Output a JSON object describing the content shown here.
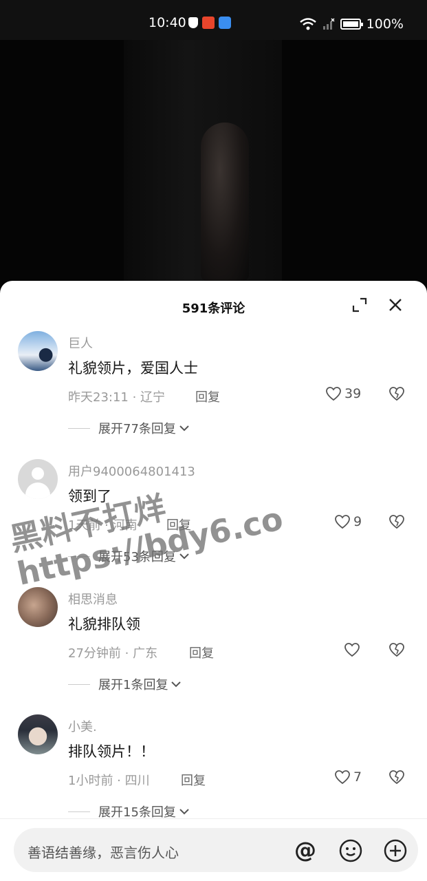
{
  "status_bar": {
    "time": "10:40",
    "battery": "100%"
  },
  "sheet": {
    "title": "591条评论"
  },
  "comments": [
    {
      "user": "巨人",
      "text": "礼貌领片，爱国人士",
      "meta": "昨天23:11 · 辽宁",
      "reply": "回复",
      "likes": "39",
      "expand": "展开77条回复"
    },
    {
      "user": "用户9400064801413",
      "text": "领到了",
      "meta": "1天前 · 河南",
      "reply": "回复",
      "likes": "9",
      "expand": "展开53条回复"
    },
    {
      "user": "相思消息",
      "text": "礼貌排队领",
      "meta": "27分钟前 · 广东",
      "reply": "回复",
      "likes": "",
      "expand": "展开1条回复"
    },
    {
      "user": "小美.",
      "text": "排队领片！！",
      "meta": "1小时前 · 四川",
      "reply": "回复",
      "likes": "7",
      "expand": "展开15条回复"
    }
  ],
  "watermark": {
    "line1": "黑料不打烊",
    "line2": "https://bdy6.co"
  },
  "input": {
    "placeholder": "善语结善缘，恶言伤人心",
    "at_symbol": "@"
  },
  "icons": {
    "expand": "expand-icon",
    "close": "close-icon",
    "like": "heart-icon",
    "dislike": "broken-heart-icon",
    "emoji": "emoji-icon",
    "add": "plus-icon"
  }
}
